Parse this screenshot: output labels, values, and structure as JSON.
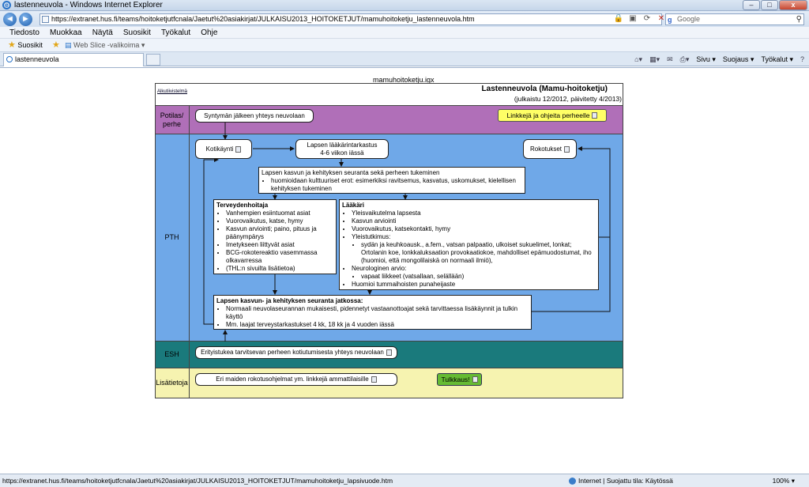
{
  "window": {
    "title": "lastenneuvola - Windows Internet Explorer",
    "min": "–",
    "max": "□",
    "close": "x"
  },
  "address": {
    "url": "https://extranet.hus.fi/teams/hoitoketjutfcnala/Jaetut%20asiakirjat/JULKAISU2013_HOITOKETJUT/mamuhoitoketju_lastenneuvola.htm",
    "search_placeholder": "Google"
  },
  "menu": [
    "Tiedosto",
    "Muokkaa",
    "Näytä",
    "Suosikit",
    "Työkalut",
    "Ohje"
  ],
  "favorites": {
    "suosikit": "Suosikit",
    "webslice": "Web Slice -valikoima ▾"
  },
  "tab": {
    "label": "lastenneuvola"
  },
  "commandbar": {
    "sivu": "Sivu ▾",
    "suojaus": "Suojaus ▾",
    "tyokalut": "Työkalut ▾",
    "help": "?"
  },
  "diagram": {
    "file_title": "mamuhoitoketju.igx",
    "home_link": "Alkutiivistelmä",
    "title": "Lastenneuvola (Mamu-hoitoketju)",
    "subtitle": "(julkaistu 12/2012, päivitetty 4/2013)",
    "lanes": {
      "potilas": "Potilas/ perhe",
      "pth": "PTH",
      "esh": "ESH",
      "lisa": "Lisätietoja"
    },
    "boxes": {
      "synt": "Syntymän jälkeen yhteys neuvolaan",
      "linkit": "Linkkejä ja ohjeita perheelle",
      "koti": "Kotikäynti",
      "laak_tark_1": "Lapsen lääkärintarkastus",
      "laak_tark_2": "4-6 viikon iässä",
      "rokotukset": "Rokotukset",
      "seuranta_head": "Lapsen kasvun ja kehityksen seuranta sekä perheen tukeminen",
      "seuranta_item": "huomioidaan kulttuuriset erot: esimerkiksi ravitsemus, kasvatus,  uskomukset, kielellisen kehityksen tukeminen",
      "th_head": "Terveydenhoitaja",
      "th_items": [
        "Vanhempien esiintuomat asiat",
        "Vuorovaikutus, katse, hymy",
        "Kasvun arviointi; paino, pituus ja päänympärys",
        "Imetykseen liittyvät asiat",
        "BCG-rokotereaktio vasemmassa olkavarressa",
        "(THL:n sivuilta lisätietoa)"
      ],
      "laakari_head": "Lääkäri",
      "laakari_items": [
        "Yleisvaikutelma lapsesta",
        "Kasvun arviointi",
        "Vuorovaikutus, katsekontakti, hymy",
        "Yleistutkimus:"
      ],
      "yleis_sub": "sydän ja keuhkoausk., a.fem., vatsan palpaatio, ulkoiset sukuelimet, lonkat; Ortolanin koe, lonkkaluksaation provokaatiokoe, mahdolliset epämuodostumat, iho (huomioi, että mongolilaiskä on normaali ilmiö),",
      "neuro": "Neurologinen arvio:",
      "neuro_sub": "vapaat liikkeet (vatsallaan, selällään)",
      "tumma": "Huomioi tummaihoisten punaheijaste",
      "jatko_head": "Lapsen kasvun- ja kehityksen seuranta jatkossa:",
      "jatko_items": [
        "Normaali neuvolaseurannan mukaisesti, pidennetyt vastaanottoajat sekä tarvittaessa lisäkäynnit ja tulkin käyttö",
        "Mm. laajat terveystarkastukset 4 kk, 18 kk ja 4 vuoden iässä"
      ],
      "esh_box": "Erityistukea tarvitsevan perheen kotiutumisesta yhteys neuvolaan",
      "lisa_box": "Eri maiden rokotusohjelmat ym. linkkejä ammattilaisille",
      "tulkkaus": "Tulkkaus!"
    }
  },
  "status": {
    "url": "https://extranet.hus.fi/teams/hoitoketjutfcnala/Jaetut%20asiakirjat/JULKAISU2013_HOITOKETJUT/mamuhoitoketju_lapsivuode.htm",
    "zone": "Internet | Suojattu tila: Käytössä",
    "zoom": "100% ▾"
  },
  "colors": {
    "potilas": "#b06fb8",
    "pth": "#6fa8e8",
    "esh": "#1a7a7c",
    "lisa": "#f6f3b0"
  }
}
